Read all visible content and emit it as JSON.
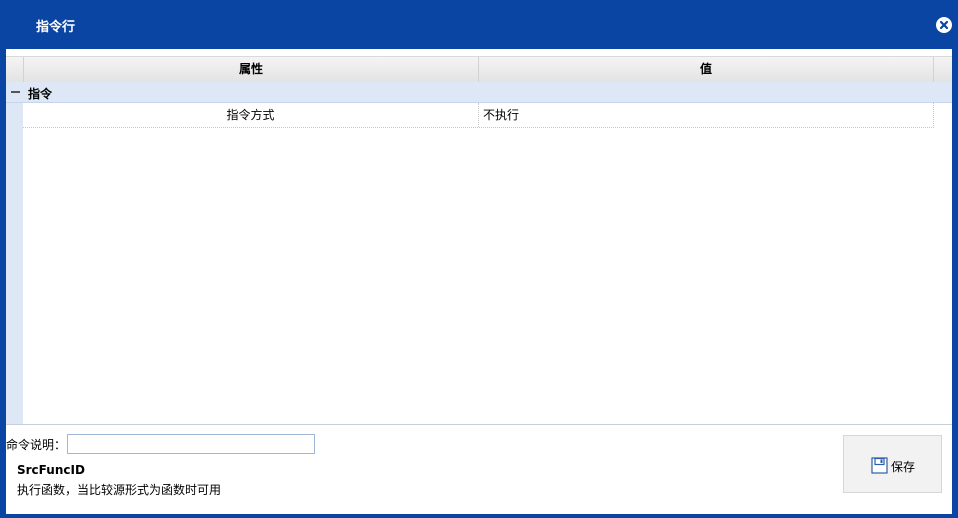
{
  "window": {
    "title": "指令行"
  },
  "grid": {
    "headers": [
      "属性",
      "值"
    ],
    "group_label": "指令",
    "rows": [
      {
        "name": "指令方式",
        "value": "不执行"
      }
    ]
  },
  "footer": {
    "desc_label": "命令说明：",
    "desc_value": "",
    "func_name": "SrcFuncID",
    "func_desc": "执行函数，当比较源形式为函数时可用",
    "save_label": "保存"
  }
}
